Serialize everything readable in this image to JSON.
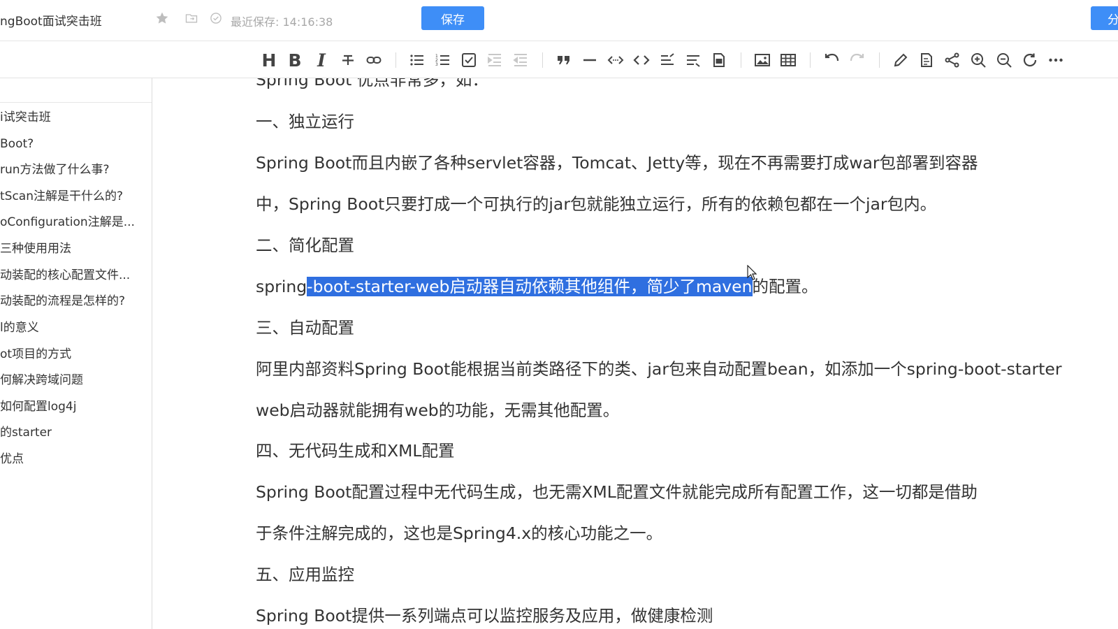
{
  "header": {
    "doc_title": "ngBoot面试突击班",
    "last_saved": "最近保存: 14:16:38",
    "save_label": "保存",
    "share_label": "分"
  },
  "toolbar": {
    "items": [
      {
        "name": "heading-icon",
        "glyph": "H"
      },
      {
        "name": "bold-icon",
        "glyph": "B"
      },
      {
        "name": "italic-icon",
        "glyph": "I"
      },
      {
        "name": "strikethrough-icon",
        "glyph": "S"
      },
      {
        "name": "link-icon"
      },
      {
        "name": "bullet-list-icon"
      },
      {
        "name": "numbered-list-icon"
      },
      {
        "name": "task-list-icon"
      },
      {
        "name": "indent-icon",
        "disabled": true
      },
      {
        "name": "outdent-icon",
        "disabled": true
      },
      {
        "name": "quote-icon"
      },
      {
        "name": "horizontal-rule-icon"
      },
      {
        "name": "inline-code-icon"
      },
      {
        "name": "code-block-icon"
      },
      {
        "name": "insert-before-icon"
      },
      {
        "name": "insert-after-icon"
      },
      {
        "name": "record-icon"
      },
      {
        "name": "image-icon"
      },
      {
        "name": "table-icon"
      },
      {
        "name": "undo-icon"
      },
      {
        "name": "redo-icon",
        "disabled": true
      },
      {
        "name": "edit-icon"
      },
      {
        "name": "preview-icon"
      },
      {
        "name": "share-icon"
      },
      {
        "name": "zoom-in-icon"
      },
      {
        "name": "zoom-out-icon"
      },
      {
        "name": "refresh-icon"
      },
      {
        "name": "more-icon"
      }
    ]
  },
  "sidebar": {
    "items": [
      {
        "label": "i试突击班"
      },
      {
        "label": "Boot?"
      },
      {
        "label": "run方法做了什么事?"
      },
      {
        "label": "tScan注解是干什么的?"
      },
      {
        "label": "oConfiguration注解是..."
      },
      {
        "label": "三种使用用法"
      },
      {
        "label": "动装配的核心配置文件..."
      },
      {
        "label": "动装配的流程是怎样的?"
      },
      {
        "label": "l的意义"
      },
      {
        "label": "ot项目的方式"
      },
      {
        "label": "何解决跨域问题"
      },
      {
        "label": "如何配置log4j"
      },
      {
        "label": "的starter"
      },
      {
        "label": "优点"
      }
    ]
  },
  "content": {
    "p0": "Spring Boot 优点非常多，如：",
    "p1": "一、独立运行",
    "p2": "Spring Boot而且内嵌了各种servlet容器，Tomcat、Jetty等，现在不再需要打成war包部署到容器",
    "p3": "中，Spring Boot只要打成一个可执行的jar包就能独立运行，所有的依赖包都在一个jar包内。",
    "p4": "二、简化配置",
    "p5_pre": "spring",
    "p5_hl": "-boot-starter-web启动器自动依赖其他组件，简少了maven",
    "p5_post": "的配置。",
    "p6": "三、自动配置",
    "p7": "阿里内部资料Spring Boot能根据当前类路径下的类、jar包来自动配置bean，如添加一个spring-boot-starter",
    "p8": "web启动器就能拥有web的功能，无需其他配置。",
    "p9": "四、无代码生成和XML配置",
    "p10": "Spring Boot配置过程中无代码生成，也无需XML配置文件就能完成所有配置工作，这一切都是借助",
    "p11": "于条件注解完成的，这也是Spring4.x的核心功能之一。",
    "p12": "五、应用监控",
    "p13": "Spring Boot提供一系列端点可以监控服务及应用，做健康检测"
  }
}
